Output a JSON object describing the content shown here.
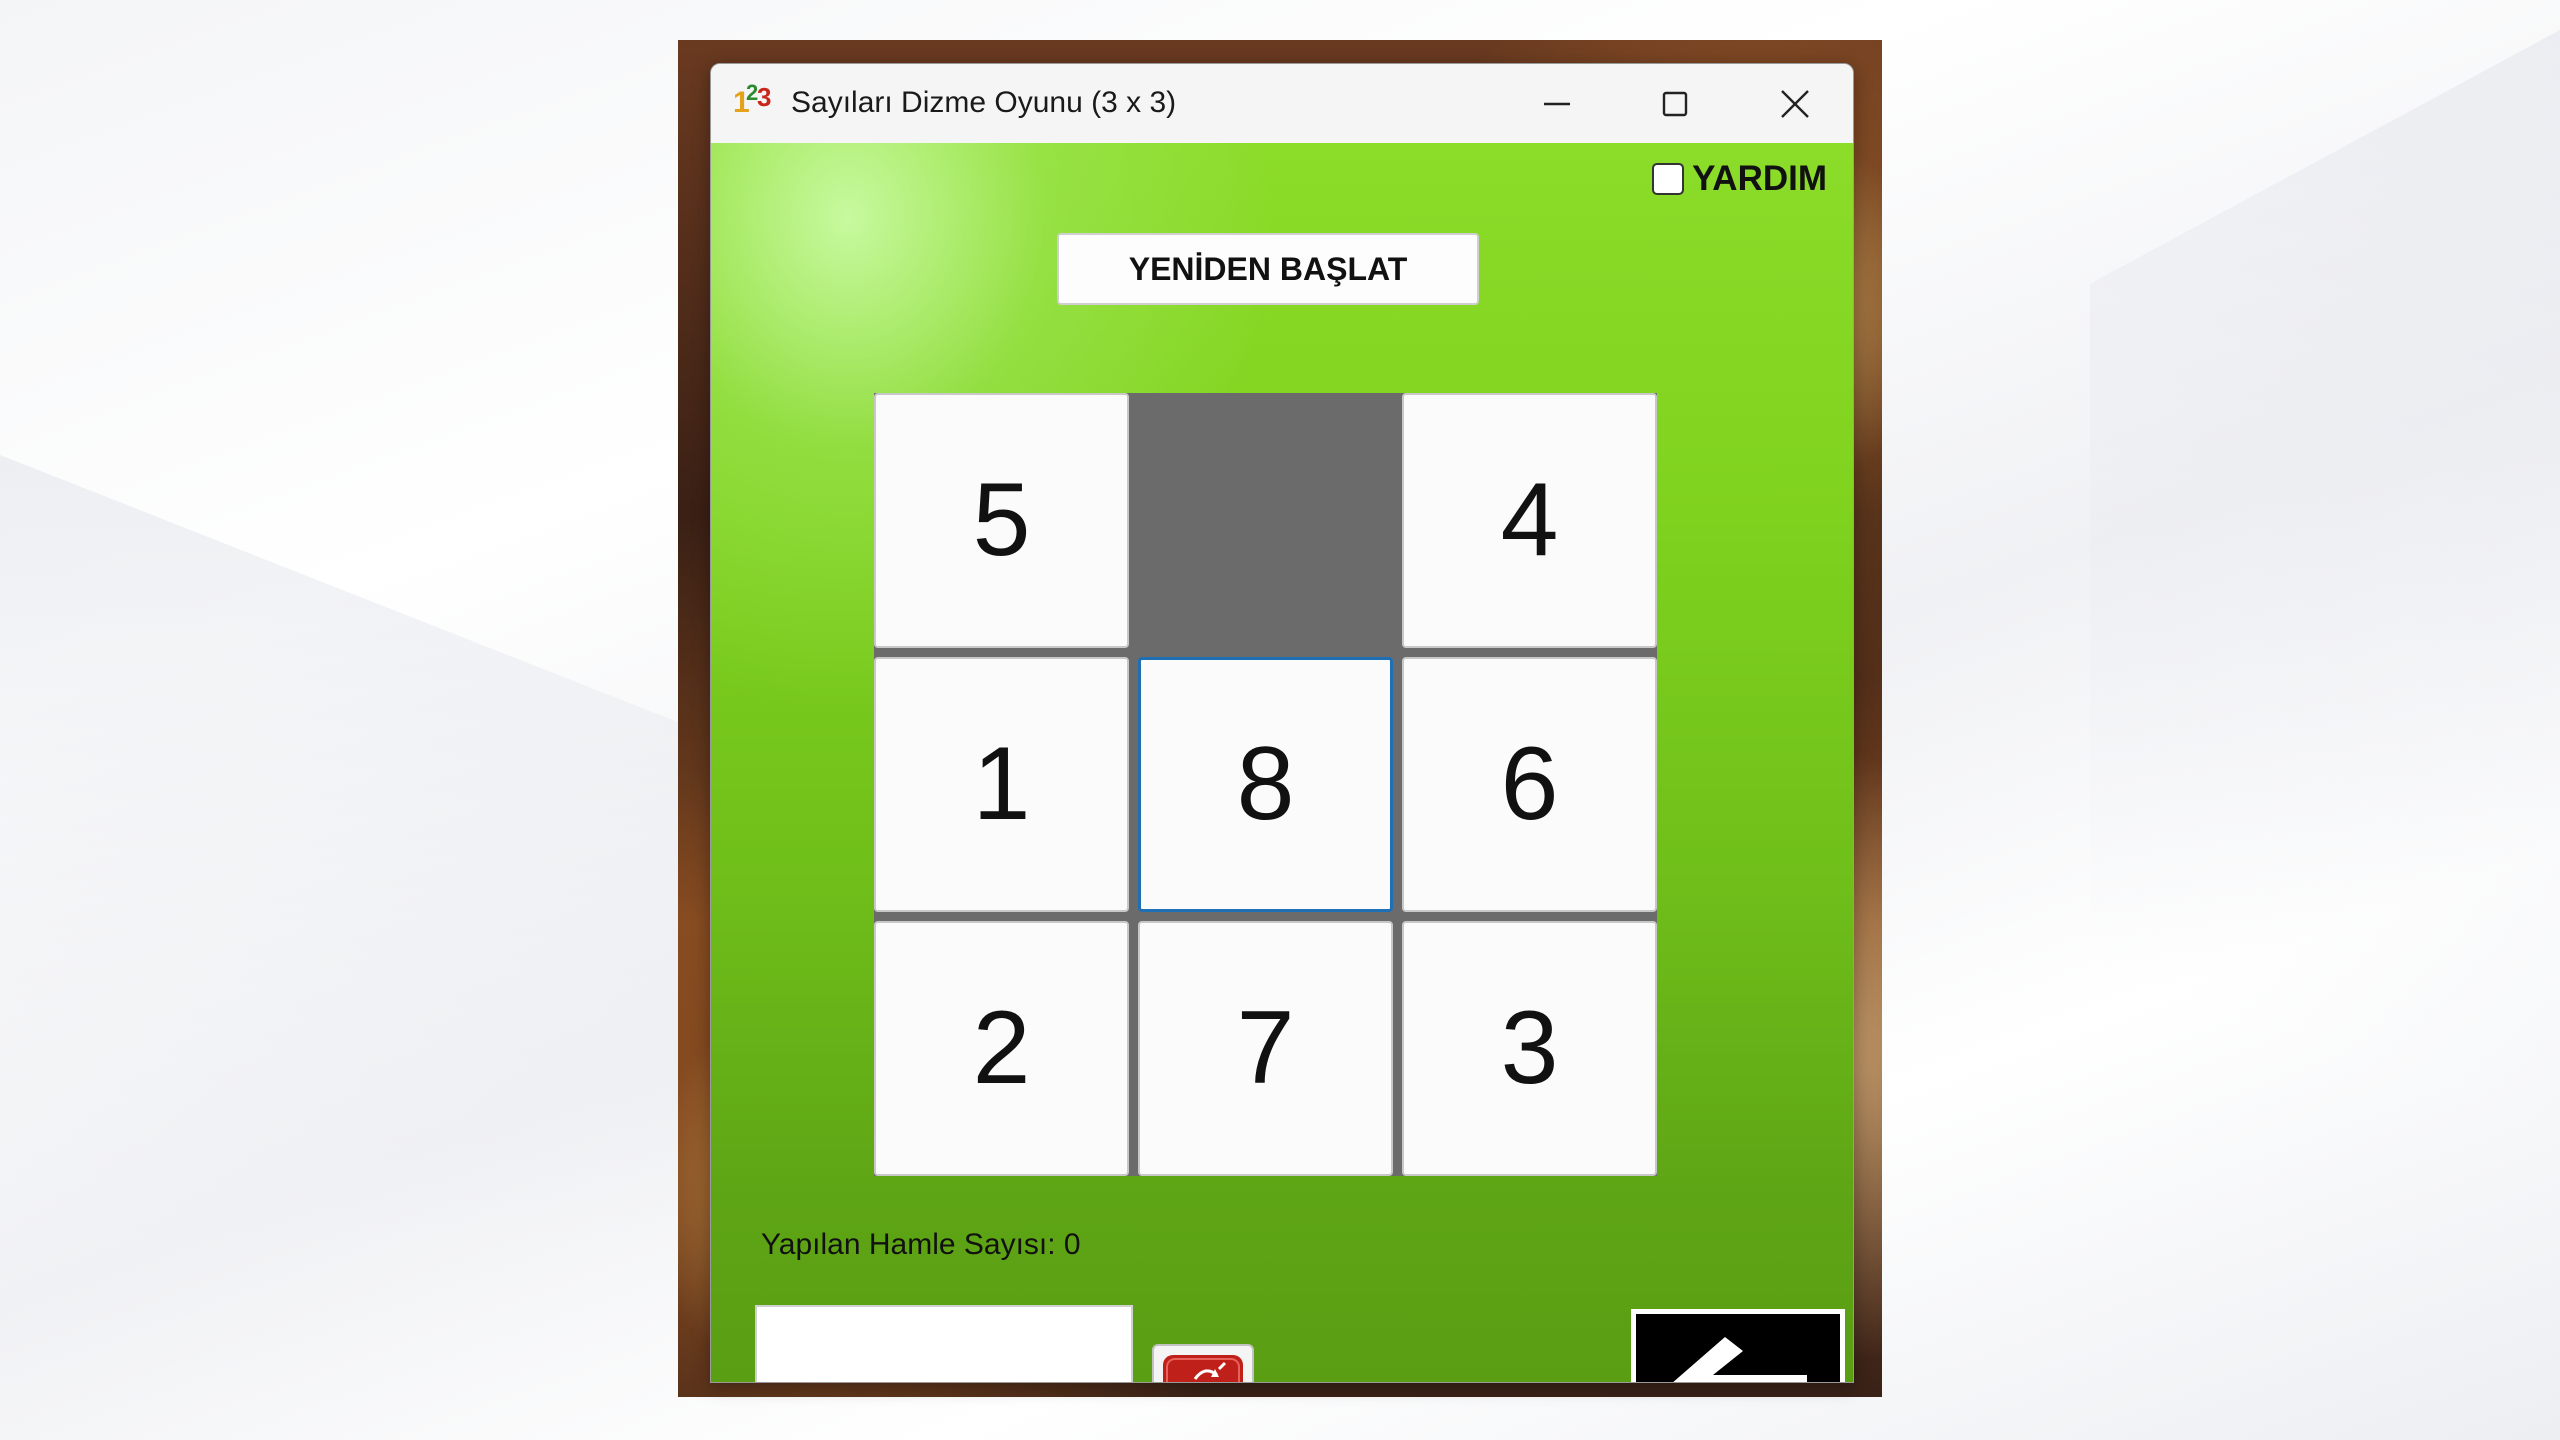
{
  "window": {
    "title": "Sayıları Dizme Oyunu (3 x 3)",
    "icon": "app-123-icon",
    "controls": [
      "minimize-icon",
      "maximize-icon",
      "close-icon"
    ]
  },
  "help": {
    "label": "YARDIM",
    "checked": false
  },
  "restart": {
    "label": "YENİDEN BAŞLAT"
  },
  "board": {
    "rows": 3,
    "cols": 3,
    "tiles": [
      "5",
      "",
      "4",
      "1",
      "8",
      "6",
      "2",
      "7",
      "3"
    ],
    "focused_index": 4
  },
  "moves": {
    "label": "Yapılan Hamle Sayısı: 0"
  },
  "input": {
    "value": ""
  },
  "icons": {
    "trash": "trash-icon",
    "back": "arrow-left-icon"
  },
  "colors": {
    "background_green": "#7fd21e",
    "empty_cell": "#6b6b6b",
    "focus_border": "#1f6fb4",
    "trash_red": "#c0201a"
  }
}
